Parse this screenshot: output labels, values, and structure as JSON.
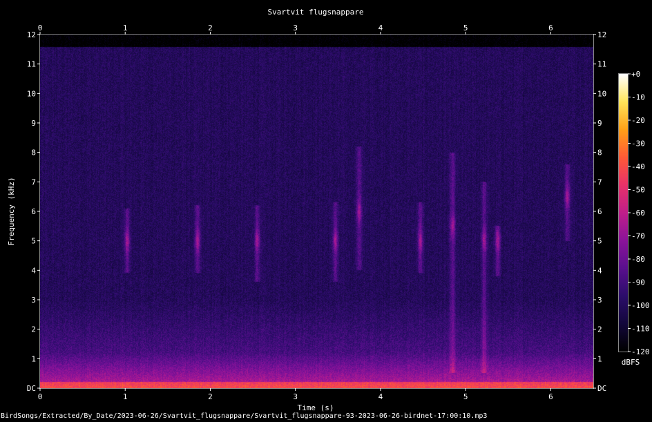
{
  "chart_data": {
    "type": "heatmap",
    "title": "Svartvit flugsnappare",
    "xlabel": "Time (s)",
    "ylabel": "Frequency (kHz)",
    "xlim": [
      0,
      6.5
    ],
    "ylim": [
      0,
      12
    ],
    "x_ticks": [
      "0",
      "1",
      "2",
      "3",
      "4",
      "5",
      "6"
    ],
    "y_ticks": [
      "DC",
      "1",
      "2",
      "3",
      "4",
      "5",
      "6",
      "7",
      "8",
      "9",
      "10",
      "11",
      "12"
    ],
    "colorbar": {
      "label": "dBFS",
      "ticks": [
        "+0",
        "-10",
        "-20",
        "-30",
        "-40",
        "-50",
        "-60",
        "-70",
        "-80",
        "-90",
        "-100",
        "-110",
        "-120"
      ],
      "range": [
        -120,
        0
      ]
    },
    "background_level_db": -100,
    "noise_cutoff_khz": 11.6,
    "song_syllables": [
      {
        "t": 1.02,
        "f_low": 3.9,
        "f_high": 6.1,
        "peak_khz": 5.0
      },
      {
        "t": 1.85,
        "f_low": 3.9,
        "f_high": 6.2,
        "peak_khz": 5.0
      },
      {
        "t": 2.55,
        "f_low": 3.6,
        "f_high": 6.2,
        "peak_khz": 5.0
      },
      {
        "t": 3.47,
        "f_low": 3.6,
        "f_high": 6.3,
        "peak_khz": 5.0
      },
      {
        "t": 3.75,
        "f_low": 4.0,
        "f_high": 8.2,
        "peak_khz": 6.0
      },
      {
        "t": 4.47,
        "f_low": 3.9,
        "f_high": 6.3,
        "peak_khz": 5.0
      },
      {
        "t": 4.85,
        "f_low": 0.5,
        "f_high": 8.0,
        "peak_khz": 5.5
      },
      {
        "t": 5.22,
        "f_low": 0.5,
        "f_high": 7.0,
        "peak_khz": 5.0
      },
      {
        "t": 5.38,
        "f_low": 3.8,
        "f_high": 5.5,
        "peak_khz": 5.0
      },
      {
        "t": 6.2,
        "f_low": 5.0,
        "f_high": 7.6,
        "peak_khz": 6.5
      }
    ]
  },
  "footer": {
    "path": "BirdSongs/Extracted/By_Date/2023-06-26/Svartvit_flugsnappare/Svartvit_flugsnappare-93-2023-06-26-birdnet-17:00:10.mp3"
  },
  "colors": {
    "background": "#000000",
    "text": "#ffffff",
    "colormap": [
      "#000000",
      "#13073c",
      "#2c0d6b",
      "#5a0f8e",
      "#8b139a",
      "#bf1e8a",
      "#e8326a",
      "#ff5a37",
      "#ffa018",
      "#ffe55a",
      "#ffffff"
    ]
  }
}
